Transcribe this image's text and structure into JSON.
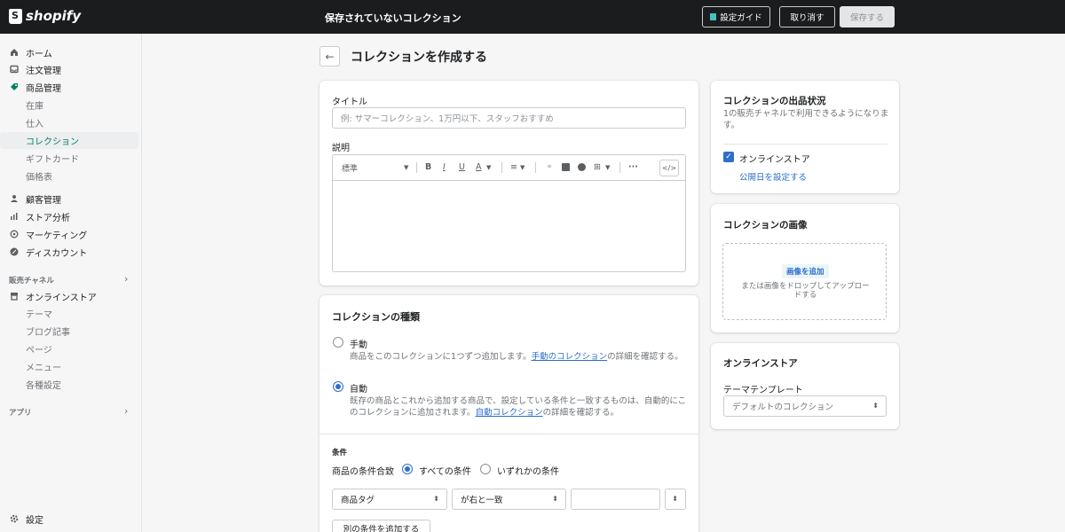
{
  "topbar": {
    "logo": "shopify",
    "title": "保存されていないコレクション",
    "guide_label": "設定ガイド",
    "cancel_label": "取り消す",
    "save_label": "保存する"
  },
  "sidebar": {
    "items": [
      {
        "label": "ホーム"
      },
      {
        "label": "注文管理"
      },
      {
        "label": "商品管理"
      },
      {
        "label": "在庫"
      },
      {
        "label": "仕入"
      },
      {
        "label": "コレクション"
      },
      {
        "label": "ギフトカード"
      },
      {
        "label": "価格表"
      },
      {
        "label": "顧客管理"
      },
      {
        "label": "ストア分析"
      },
      {
        "label": "マーケティング"
      },
      {
        "label": "ディスカウント"
      },
      {
        "label": "オンラインストア"
      },
      {
        "label": "テーマ"
      },
      {
        "label": "ブログ記事"
      },
      {
        "label": "ページ"
      },
      {
        "label": "メニュー"
      },
      {
        "label": "各種設定"
      },
      {
        "label": "設定"
      }
    ],
    "sales_channels": "販売チャネル",
    "apps": "アプリ"
  },
  "page": {
    "title": "コレクションを作成する"
  },
  "main_card": {
    "title_label": "タイトル",
    "title_placeholder": "例: サマーコレクション、1万円以下、スタッフおすすめ",
    "desc_label": "説明",
    "format_select": "標準"
  },
  "type_card": {
    "heading": "コレクションの種類",
    "manual": {
      "label": "手動",
      "desc_before": "商品をこのコレクションに1つずつ追加します。",
      "desc_link": "手動のコレクション",
      "desc_after": "の詳細を確認する。"
    },
    "auto": {
      "label": "自動",
      "desc_before": "既存の商品とこれから追加する商品で、設定している条件と一致するものは、自動的にこのコレクションに追加されます。",
      "desc_link": "自動コレクション",
      "desc_after": "の詳細を確認する。"
    },
    "conditions_heading": "条件",
    "match_label": "商品の条件合致",
    "all_label": "すべての条件",
    "any_label": "いずれかの条件",
    "field_select": "商品タグ",
    "op_select": "が右と一致",
    "add_button": "別の条件を追加する"
  },
  "status_card": {
    "heading": "コレクションの出品状況",
    "desc": "1の販売チャネルで利用できるようになります。",
    "channel": "オンラインストア",
    "schedule_link": "公開日を設定する"
  },
  "image_card": {
    "heading": "コレクションの画像",
    "add_label": "画像を追加",
    "drop_text": "または画像をドロップしてアップロードする"
  },
  "store_card": {
    "heading": "オンラインストア",
    "template_label": "テーマテンプレート",
    "template_value": "デフォルトのコレクション"
  },
  "colors": {
    "accent": "#008060",
    "link": "#2c6ecb",
    "topbar": "#1a1c1d"
  }
}
